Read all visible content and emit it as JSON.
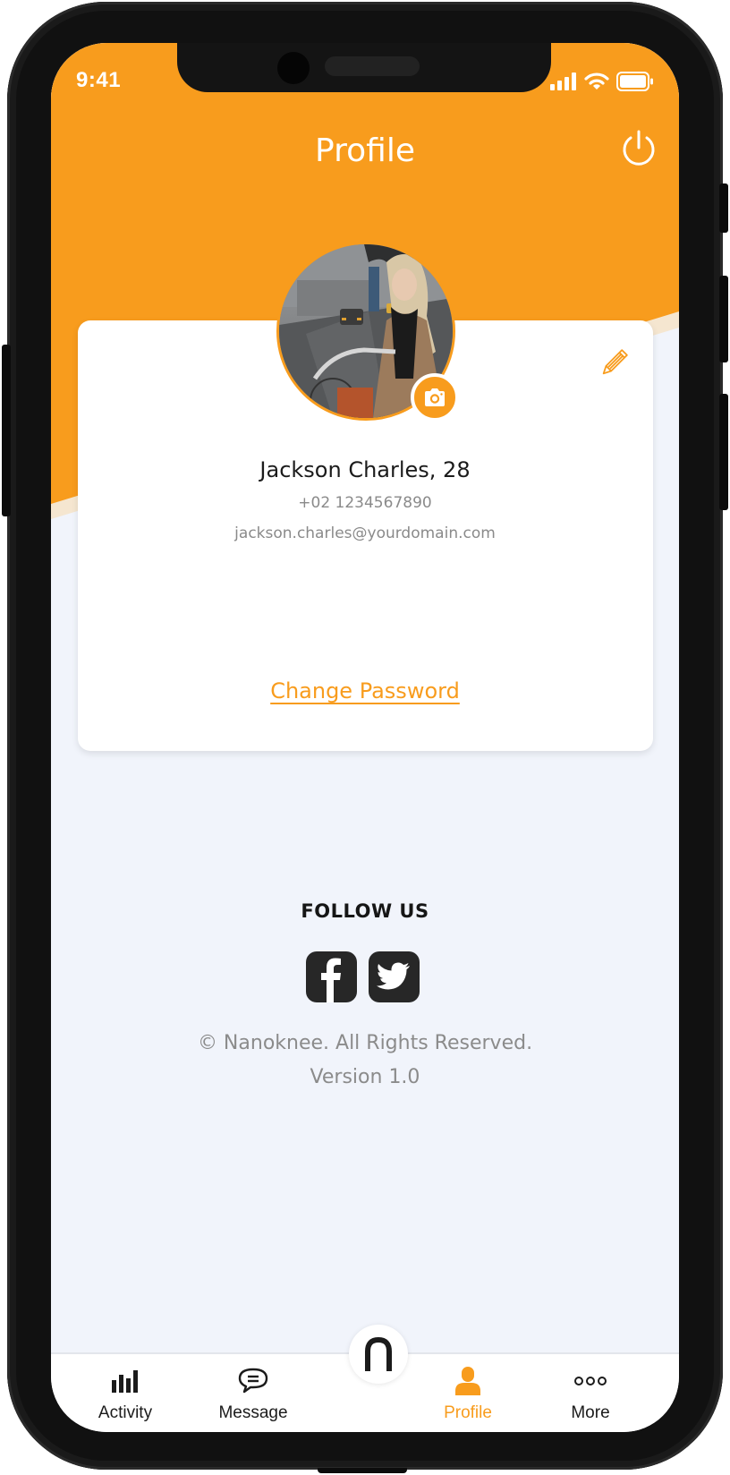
{
  "status_bar": {
    "time": "9:41",
    "icons": [
      "signal-icon",
      "wifi-icon",
      "battery-icon"
    ]
  },
  "header": {
    "title": "Profile",
    "power_icon": "power-icon"
  },
  "profile": {
    "name": "Jackson Charles, 28",
    "phone": "+02 1234567890",
    "email": "jackson.charles@yourdomain.com",
    "change_password_label": "Change Password",
    "edit_icon": "pencil-icon",
    "camera_icon": "camera-icon"
  },
  "footer": {
    "follow_title": "FOLLOW US",
    "social": [
      {
        "name": "facebook",
        "icon": "facebook-icon"
      },
      {
        "name": "twitter",
        "icon": "twitter-icon"
      }
    ],
    "copyright": "© Nanoknee. All Rights Reserved.",
    "version": "Version 1.0"
  },
  "tabbar": {
    "tabs": [
      {
        "label": "Activity",
        "icon": "bar-chart-icon",
        "active": false
      },
      {
        "label": "Message",
        "icon": "chat-bubble-icon",
        "active": false
      },
      {
        "label": "Profile",
        "icon": "user-icon",
        "active": true
      },
      {
        "label": "More",
        "icon": "more-dots-icon",
        "active": false
      }
    ],
    "center_icon": "nanoknee-logo-icon"
  },
  "colors": {
    "accent": "#f89c1d",
    "background": "#f1f4fb",
    "card": "#ffffff",
    "text_dark": "#1b1b1b",
    "text_muted": "#8a8a8a"
  }
}
